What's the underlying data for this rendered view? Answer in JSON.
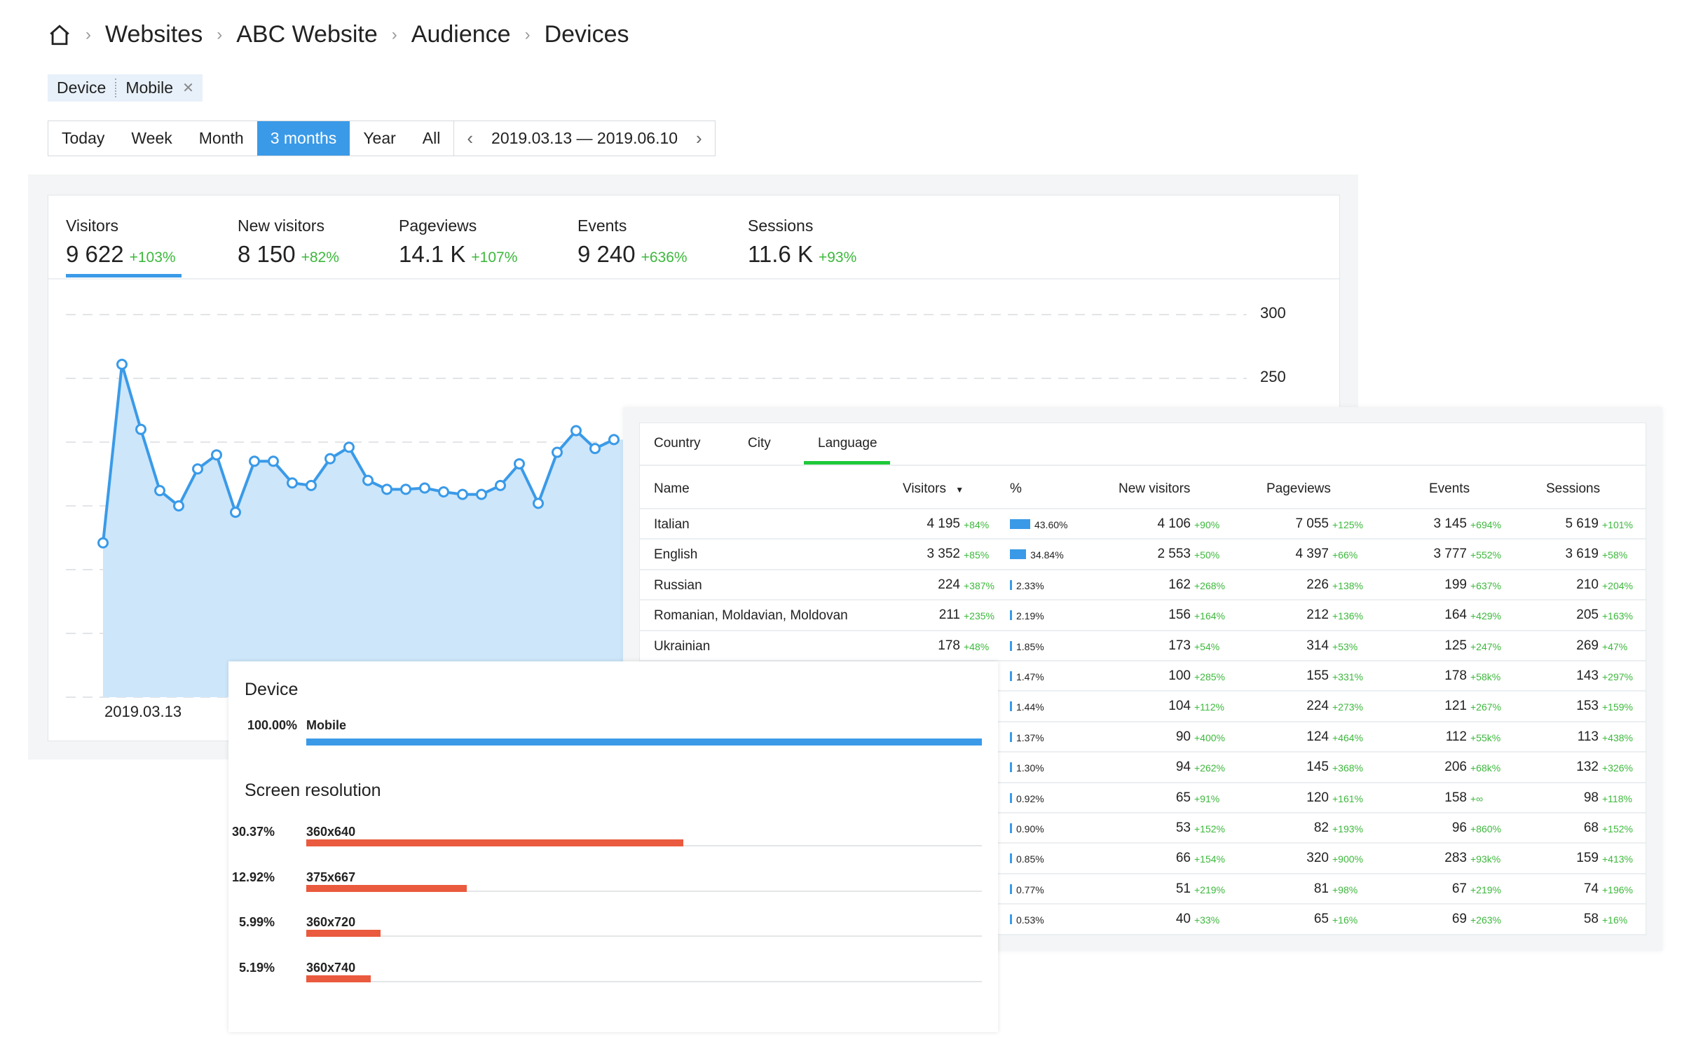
{
  "breadcrumb": [
    "Websites",
    "ABC Website",
    "Audience",
    "Devices"
  ],
  "filter": {
    "key": "Device",
    "value": "Mobile"
  },
  "periods": [
    "Today",
    "Week",
    "Month",
    "3 months",
    "Year",
    "All"
  ],
  "active_period": "3 months",
  "date_range": "2019.03.13 — 2019.06.10",
  "metrics": [
    {
      "label": "Visitors",
      "value": "9 622",
      "delta": "+103%"
    },
    {
      "label": "New visitors",
      "value": "8 150",
      "delta": "+82%"
    },
    {
      "label": "Pageviews",
      "value": "14.1 K",
      "delta": "+107%"
    },
    {
      "label": "Events",
      "value": "9 240",
      "delta": "+636%"
    },
    {
      "label": "Sessions",
      "value": "11.6 K",
      "delta": "+93%"
    }
  ],
  "chart_data": {
    "type": "area",
    "series": [
      {
        "values": [
          121,
          261,
          210,
          162,
          150,
          179,
          190,
          145,
          185,
          185,
          168,
          166,
          187,
          196,
          170,
          163,
          163,
          164,
          161,
          159,
          159,
          166,
          183,
          152,
          192,
          209,
          195,
          202
        ]
      }
    ],
    "x_labels": [
      "2019.03.13"
    ],
    "y_ticks": [
      "300",
      "250"
    ],
    "ylim": [
      0,
      300
    ],
    "grid": true,
    "color": "#3a9ae8"
  },
  "table": {
    "tabs": [
      "Country",
      "City",
      "Language"
    ],
    "active_tab": "Language",
    "headers": {
      "name": "Name",
      "visitors": "Visitors",
      "pct": "%",
      "new": "New visitors",
      "pageviews": "Pageviews",
      "events": "Events",
      "sessions": "Sessions"
    },
    "rows": [
      {
        "name": "Italian",
        "v": "4 195",
        "vd": "+84%",
        "p": "43.60%",
        "pv": 43.6,
        "n": "4 106",
        "nd": "+90%",
        "pg": "7 055",
        "pgd": "+125%",
        "e": "3 145",
        "ed": "+694%",
        "s": "5 619",
        "sd": "+101%"
      },
      {
        "name": "English",
        "v": "3 352",
        "vd": "+85%",
        "p": "34.84%",
        "pv": 34.84,
        "n": "2 553",
        "nd": "+50%",
        "pg": "4 397",
        "pgd": "+66%",
        "e": "3 777",
        "ed": "+552%",
        "s": "3 619",
        "sd": "+58%"
      },
      {
        "name": "Russian",
        "v": "224",
        "vd": "+387%",
        "p": "2.33%",
        "pv": 2.33,
        "n": "162",
        "nd": "+268%",
        "pg": "226",
        "pgd": "+138%",
        "e": "199",
        "ed": "+637%",
        "s": "210",
        "sd": "+204%"
      },
      {
        "name": "Romanian, Moldavian, Moldovan",
        "v": "211",
        "vd": "+235%",
        "p": "2.19%",
        "pv": 2.19,
        "n": "156",
        "nd": "+164%",
        "pg": "212",
        "pgd": "+136%",
        "e": "164",
        "ed": "+429%",
        "s": "205",
        "sd": "+163%"
      },
      {
        "name": "Ukrainian",
        "v": "178",
        "vd": "+48%",
        "p": "1.85%",
        "pv": 1.85,
        "n": "173",
        "nd": "+54%",
        "pg": "314",
        "pgd": "+53%",
        "e": "125",
        "ed": "+247%",
        "s": "269",
        "sd": "+47%"
      },
      {
        "p": "1.47%",
        "pv": 1.47,
        "n": "100",
        "nd": "+285%",
        "pg": "155",
        "pgd": "+331%",
        "e": "178",
        "ed": "+58k%",
        "s": "143",
        "sd": "+297%"
      },
      {
        "p": "1.44%",
        "pv": 1.44,
        "n": "104",
        "nd": "+112%",
        "pg": "224",
        "pgd": "+273%",
        "e": "121",
        "ed": "+267%",
        "s": "153",
        "sd": "+159%"
      },
      {
        "p": "1.37%",
        "pv": 1.37,
        "n": "90",
        "nd": "+400%",
        "pg": "124",
        "pgd": "+464%",
        "e": "112",
        "ed": "+55k%",
        "s": "113",
        "sd": "+438%"
      },
      {
        "p": "1.30%",
        "pv": 1.3,
        "n": "94",
        "nd": "+262%",
        "pg": "145",
        "pgd": "+368%",
        "e": "206",
        "ed": "+68k%",
        "s": "132",
        "sd": "+326%"
      },
      {
        "p": "0.92%",
        "pv": 0.92,
        "n": "65",
        "nd": "+91%",
        "pg": "120",
        "pgd": "+161%",
        "e": "158",
        "ed": "+∞",
        "s": "98",
        "sd": "+118%"
      },
      {
        "p": "0.90%",
        "pv": 0.9,
        "n": "53",
        "nd": "+152%",
        "pg": "82",
        "pgd": "+193%",
        "e": "96",
        "ed": "+860%",
        "s": "68",
        "sd": "+152%"
      },
      {
        "p": "0.85%",
        "pv": 0.85,
        "n": "66",
        "nd": "+154%",
        "pg": "320",
        "pgd": "+900%",
        "e": "283",
        "ed": "+93k%",
        "s": "159",
        "sd": "+413%"
      },
      {
        "p": "0.77%",
        "pv": 0.77,
        "n": "51",
        "nd": "+219%",
        "pg": "81",
        "pgd": "+98%",
        "e": "67",
        "ed": "+219%",
        "s": "74",
        "sd": "+196%"
      },
      {
        "p": "0.53%",
        "pv": 0.53,
        "n": "40",
        "nd": "+33%",
        "pg": "65",
        "pgd": "+16%",
        "e": "69",
        "ed": "+263%",
        "s": "58",
        "sd": "+16%"
      }
    ]
  },
  "device": {
    "title": "Device",
    "items": [
      {
        "pct": "100.00%",
        "value": 100,
        "label": "Mobile"
      }
    ],
    "color": "#3a9ae8"
  },
  "resolution": {
    "title": "Screen resolution",
    "items": [
      {
        "pct": "30.37%",
        "value": 30.37,
        "label": "360x640"
      },
      {
        "pct": "12.92%",
        "value": 12.92,
        "label": "375x667"
      },
      {
        "pct": "5.99%",
        "value": 5.99,
        "label": "360x720"
      },
      {
        "pct": "5.19%",
        "value": 5.19,
        "label": "360x740"
      }
    ],
    "color": "#ea5a3e"
  }
}
